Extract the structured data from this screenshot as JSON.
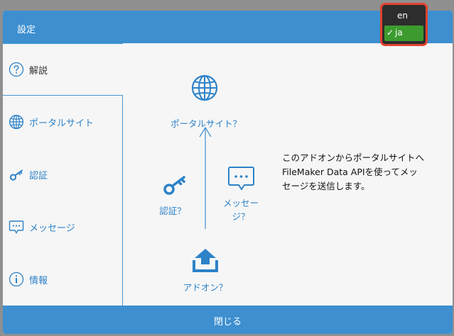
{
  "header": {
    "title": "設定"
  },
  "sidebar": {
    "items": [
      {
        "label": "解説",
        "icon": "help-icon"
      },
      {
        "label": "ポータルサイト",
        "icon": "globe-icon"
      },
      {
        "label": "認証",
        "icon": "key-icon"
      },
      {
        "label": "メッセージ",
        "icon": "message-icon"
      },
      {
        "label": "情報",
        "icon": "info-icon"
      }
    ]
  },
  "diagram": {
    "portal_label": "ポータルサイト？",
    "auth_label": "認証？",
    "message_label_line1": "メッセー",
    "message_label_line2": "ジ？",
    "addon_label": "アドオン？"
  },
  "description": {
    "line1": "このアドオンからポータルサイトへ",
    "line2": "FileMaker Data APIを使ってメッ",
    "line3": "セージを送信します。"
  },
  "footer": {
    "close_label": "閉じる"
  },
  "language_menu": {
    "options": [
      "en",
      "ja"
    ],
    "selected": "ja",
    "check": "✓"
  },
  "colors": {
    "accent": "#3d8fd0",
    "text_link": "#2d82c8",
    "highlight_border": "#e0432e",
    "selected_bg": "#3c9b2e"
  }
}
